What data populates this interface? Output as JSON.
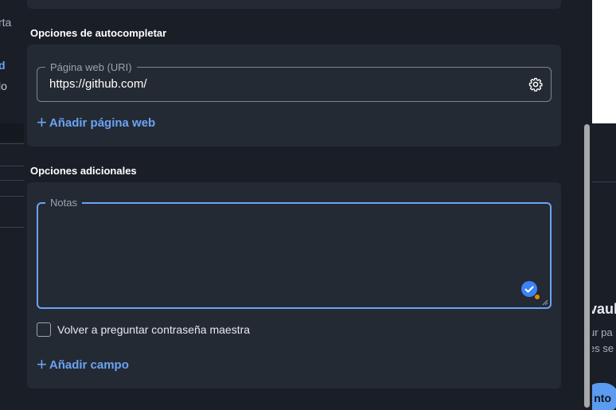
{
  "background_left": {
    "text_1": "rta",
    "text_2": "d",
    "text_3": "lo"
  },
  "background_right": {
    "title": "vaul",
    "line_1": "ur pa",
    "line_2": "es se",
    "button_label": "nto"
  },
  "autofill": {
    "section_title": "Opciones de autocompletar",
    "uri_label": "Página web (URI)",
    "uri_value": "https://github.com/",
    "add_website_label": "Añadir página web"
  },
  "additional": {
    "section_title": "Opciones adicionales",
    "notes_label": "Notas",
    "notes_value": "",
    "reprompt_label": "Volver a preguntar contraseña maestra",
    "reprompt_checked": false,
    "add_field_label": "Añadir campo"
  },
  "colors": {
    "accent": "#6aa3f5",
    "dialog_bg": "#1a1f27",
    "card_bg": "#242a33"
  }
}
